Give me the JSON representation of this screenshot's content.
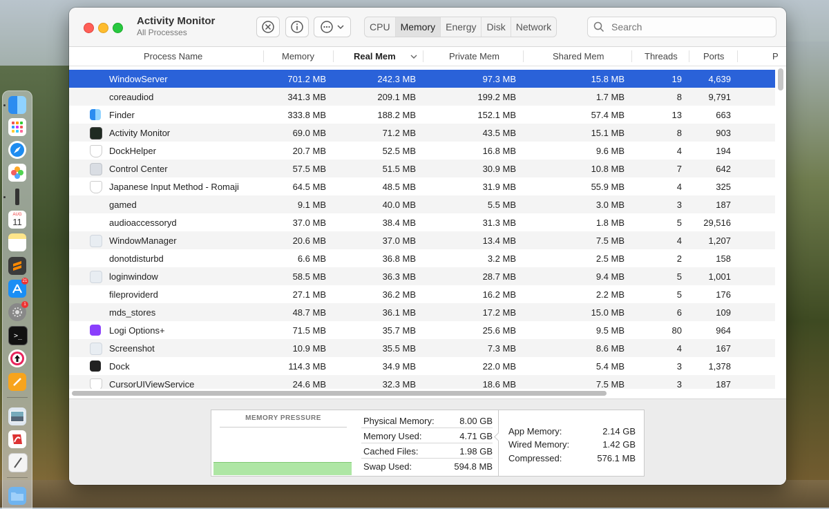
{
  "app": {
    "title": "Activity Monitor",
    "subtitle": "All Processes"
  },
  "toolbar": {
    "stop_icon": "x-circle-icon",
    "info_icon": "info-icon",
    "more_icon": "ellipsis-circle-icon"
  },
  "tabs": [
    "CPU",
    "Memory",
    "Energy",
    "Disk",
    "Network"
  ],
  "active_tab": "Memory",
  "search": {
    "placeholder": "Search"
  },
  "columns": [
    "Process Name",
    "Memory",
    "Real Mem",
    "Private Mem",
    "Shared Mem",
    "Threads",
    "Ports",
    "P"
  ],
  "sorted_column": "Real Mem",
  "processes": [
    {
      "name": "WindowServer",
      "memory": "701.2 MB",
      "real_mem": "242.3 MB",
      "private_mem": "97.3 MB",
      "shared_mem": "15.8 MB",
      "threads": "19",
      "ports": "4,639",
      "icon": "none",
      "selected": true
    },
    {
      "name": "coreaudiod",
      "memory": "341.3 MB",
      "real_mem": "209.1 MB",
      "private_mem": "199.2 MB",
      "shared_mem": "1.7 MB",
      "threads": "8",
      "ports": "9,791",
      "icon": "none"
    },
    {
      "name": "Finder",
      "memory": "333.8 MB",
      "real_mem": "188.2 MB",
      "private_mem": "152.1 MB",
      "shared_mem": "57.4 MB",
      "threads": "13",
      "ports": "663",
      "icon": "finder-icon"
    },
    {
      "name": "Activity Monitor",
      "memory": "69.0 MB",
      "real_mem": "71.2 MB",
      "private_mem": "43.5 MB",
      "shared_mem": "15.1 MB",
      "threads": "8",
      "ports": "903",
      "icon": "activity-monitor-icon"
    },
    {
      "name": "DockHelper",
      "memory": "20.7 MB",
      "real_mem": "52.5 MB",
      "private_mem": "16.8 MB",
      "shared_mem": "9.6 MB",
      "threads": "4",
      "ports": "194",
      "icon": "shield-icon"
    },
    {
      "name": "Control Center",
      "memory": "57.5 MB",
      "real_mem": "51.5 MB",
      "private_mem": "30.9 MB",
      "shared_mem": "10.8 MB",
      "threads": "7",
      "ports": "642",
      "icon": "control-center-icon"
    },
    {
      "name": "Japanese Input Method - Romaji",
      "memory": "64.5 MB",
      "real_mem": "48.5 MB",
      "private_mem": "31.9 MB",
      "shared_mem": "55.9 MB",
      "threads": "4",
      "ports": "325",
      "icon": "shield-icon"
    },
    {
      "name": "gamed",
      "memory": "9.1 MB",
      "real_mem": "40.0 MB",
      "private_mem": "5.5 MB",
      "shared_mem": "3.0 MB",
      "threads": "3",
      "ports": "187",
      "icon": "none"
    },
    {
      "name": "audioaccessoryd",
      "memory": "37.0 MB",
      "real_mem": "38.4 MB",
      "private_mem": "31.3 MB",
      "shared_mem": "1.8 MB",
      "threads": "5",
      "ports": "29,516",
      "icon": "none"
    },
    {
      "name": "WindowManager",
      "memory": "20.6 MB",
      "real_mem": "37.0 MB",
      "private_mem": "13.4 MB",
      "shared_mem": "7.5 MB",
      "threads": "4",
      "ports": "1,207",
      "icon": "generic-app-icon"
    },
    {
      "name": "donotdisturbd",
      "memory": "6.6 MB",
      "real_mem": "36.8 MB",
      "private_mem": "3.2 MB",
      "shared_mem": "2.5 MB",
      "threads": "2",
      "ports": "158",
      "icon": "none"
    },
    {
      "name": "loginwindow",
      "memory": "58.5 MB",
      "real_mem": "36.3 MB",
      "private_mem": "28.7 MB",
      "shared_mem": "9.4 MB",
      "threads": "5",
      "ports": "1,001",
      "icon": "generic-app-icon"
    },
    {
      "name": "fileproviderd",
      "memory": "27.1 MB",
      "real_mem": "36.2 MB",
      "private_mem": "16.2 MB",
      "shared_mem": "2.2 MB",
      "threads": "5",
      "ports": "176",
      "icon": "none"
    },
    {
      "name": "mds_stores",
      "memory": "48.7 MB",
      "real_mem": "36.1 MB",
      "private_mem": "17.2 MB",
      "shared_mem": "15.0 MB",
      "threads": "6",
      "ports": "109",
      "icon": "none"
    },
    {
      "name": "Logi Options+",
      "memory": "71.5 MB",
      "real_mem": "35.7 MB",
      "private_mem": "25.6 MB",
      "shared_mem": "9.5 MB",
      "threads": "80",
      "ports": "964",
      "icon": "logi-icon"
    },
    {
      "name": "Screenshot",
      "memory": "10.9 MB",
      "real_mem": "35.5 MB",
      "private_mem": "7.3 MB",
      "shared_mem": "8.6 MB",
      "threads": "4",
      "ports": "167",
      "icon": "generic-app-icon"
    },
    {
      "name": "Dock",
      "memory": "114.3 MB",
      "real_mem": "34.9 MB",
      "private_mem": "22.0 MB",
      "shared_mem": "5.4 MB",
      "threads": "3",
      "ports": "1,378",
      "icon": "dock-icon"
    },
    {
      "name": "CursorUIViewService",
      "memory": "24.6 MB",
      "real_mem": "32.3 MB",
      "private_mem": "18.6 MB",
      "shared_mem": "7.5 MB",
      "threads": "3",
      "ports": "187",
      "icon": "shield-icon"
    }
  ],
  "memory_pressure": {
    "title": "MEMORY PRESSURE",
    "color": "#aee6a4",
    "level": 0.2
  },
  "memory_stats": [
    {
      "label": "Physical Memory:",
      "value": "8.00 GB"
    },
    {
      "label": "Memory Used:",
      "value": "4.71 GB"
    },
    {
      "label": "Cached Files:",
      "value": "1.98 GB"
    },
    {
      "label": "Swap Used:",
      "value": "594.8 MB"
    }
  ],
  "memory_breakdown": [
    {
      "label": "App Memory:",
      "value": "2.14 GB"
    },
    {
      "label": "Wired Memory:",
      "value": "1.42 GB"
    },
    {
      "label": "Compressed:",
      "value": "576.1 MB"
    }
  ],
  "dock": {
    "apps": [
      "finder-icon",
      "launchpad-icon",
      "safari-icon",
      "photos-icon",
      "terminal-icon",
      "calendar-icon",
      "notes-icon",
      "sublime-icon",
      "app-store-icon",
      "system-settings-icon",
      "iterm-icon",
      "upload-icon",
      "pages-icon",
      "preview-icon",
      "pdf-icon",
      "textedit-icon",
      "folder-icon"
    ],
    "calendar_month": "AUG",
    "calendar_day": "11",
    "app_store_badge": "21",
    "settings_badge": "1"
  },
  "accent_color": "#2a62d9"
}
